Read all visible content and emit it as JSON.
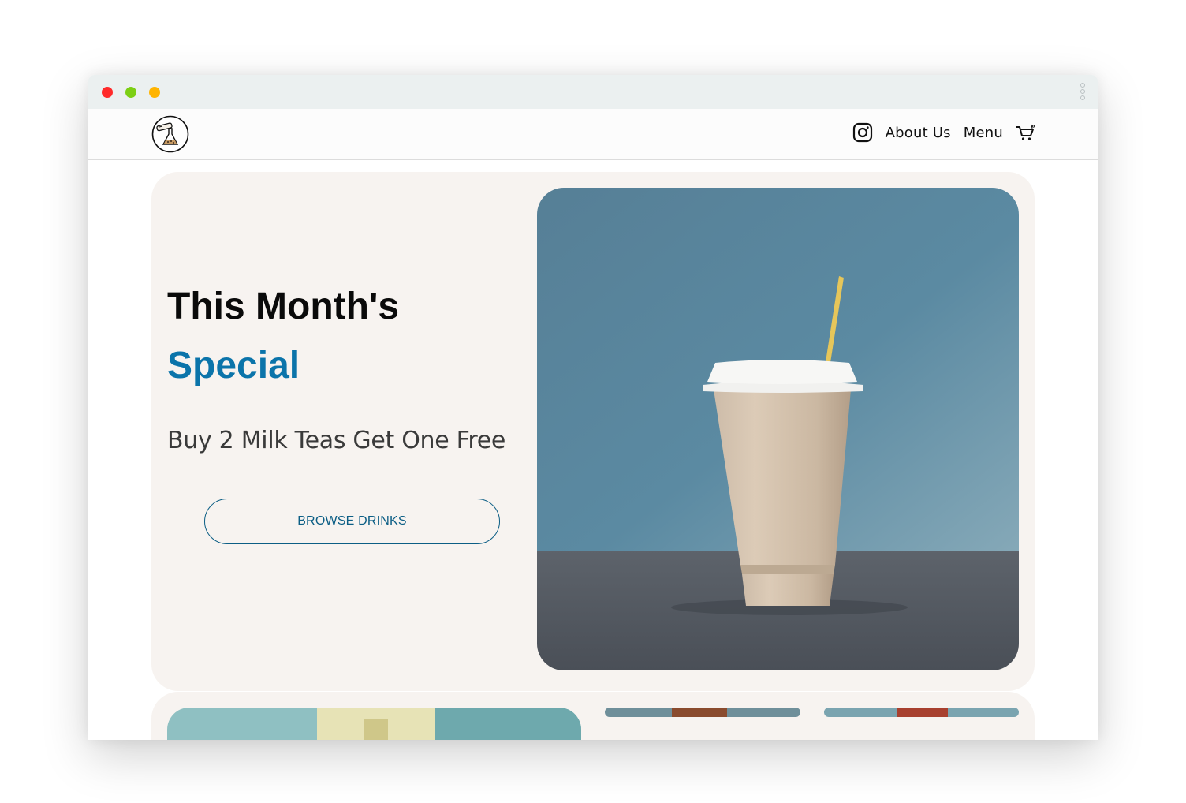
{
  "window": {
    "controls": [
      "close",
      "minimize",
      "maximize"
    ]
  },
  "nav": {
    "logo_icon": "boba-flask-logo-icon",
    "instagram_icon": "instagram-icon",
    "about_label": "About Us",
    "menu_label": "Menu",
    "cart_icon": "cart-icon"
  },
  "hero": {
    "title_line1": "This Month's",
    "title_line2": "Special",
    "subtitle": "Buy 2 Milk Teas Get One Free",
    "cta_label": "BROWSE DRINKS",
    "image": "milk-tea-cup-image"
  },
  "colors": {
    "accent": "#0b74aa",
    "button_border": "#0c5e85",
    "hero_bg": "#f7f3f0",
    "titlebar_bg": "#ebf0f0"
  }
}
